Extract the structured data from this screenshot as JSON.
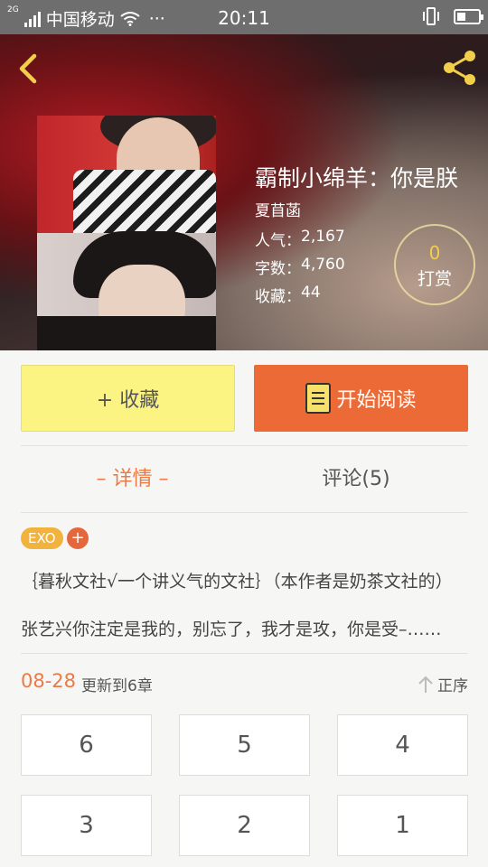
{
  "status_bar": {
    "network_label": "2G",
    "carrier": "中国移动",
    "more": "···",
    "time": "20:11"
  },
  "header": {
    "back_icon": "back-chevron-icon",
    "share_icon": "share-icon",
    "accent_color": "#f2cf4a"
  },
  "book": {
    "title": "霸制小绵羊：你是朕",
    "author": "夏苜菡",
    "stats": [
      {
        "label": "人气：",
        "value": "2,167"
      },
      {
        "label": "字数：",
        "value": "4,760"
      },
      {
        "label": "收藏：",
        "value": "44"
      }
    ],
    "reward": {
      "count": "0",
      "label": "打赏"
    }
  },
  "actions": {
    "favorite_label": "+ 收藏",
    "read_label": "开始阅读",
    "favorite_color": "#fcf482",
    "read_color": "#ec6a36"
  },
  "tabs": {
    "detail": "– 详情 –",
    "comments": "评论(5)"
  },
  "tags": {
    "items": [
      "EXO"
    ],
    "add": "+"
  },
  "description": {
    "line1": "｛暮秋文社√一个讲义气的文社｝（本作者是奶茶文社的）",
    "line2": "张艺兴你注定是我的，别忘了，我才是攻，你是受–……"
  },
  "updates": {
    "date": "08-28",
    "text": "更新到6章",
    "sort_label": "正序"
  },
  "chapters": [
    "6",
    "5",
    "4",
    "3",
    "2",
    "1"
  ]
}
